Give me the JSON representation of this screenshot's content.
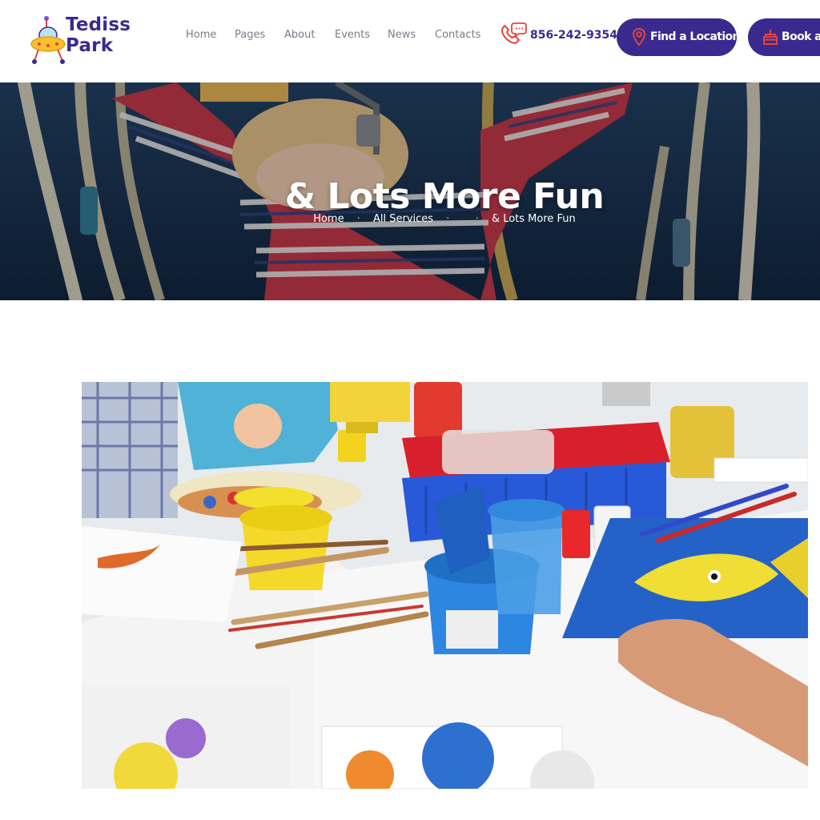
{
  "brand": {
    "name_line1": "Tediss",
    "name_line2": "Park"
  },
  "nav": {
    "items": [
      "Home",
      "Pages",
      "About",
      "Events",
      "News",
      "Contacts"
    ]
  },
  "contact": {
    "phone": "856-242-9354"
  },
  "buttons": {
    "find_location": "Find a Location",
    "book": "Book a Party"
  },
  "hero": {
    "title": "& Lots More Fun",
    "breadcrumb": [
      "Home",
      "All Services",
      "",
      "& Lots More Fun"
    ]
  },
  "icons": {
    "logo": "ufo-logo-icon",
    "phone": "phone-chat-icon",
    "location": "map-pin-icon",
    "book": "cake-icon"
  },
  "colors": {
    "brand": "#3a2a8f",
    "nav_text": "#7b7b86",
    "button_text": "#ffffff",
    "logo_ufo": "#f6c12f",
    "accent_red": "#e8433a"
  }
}
